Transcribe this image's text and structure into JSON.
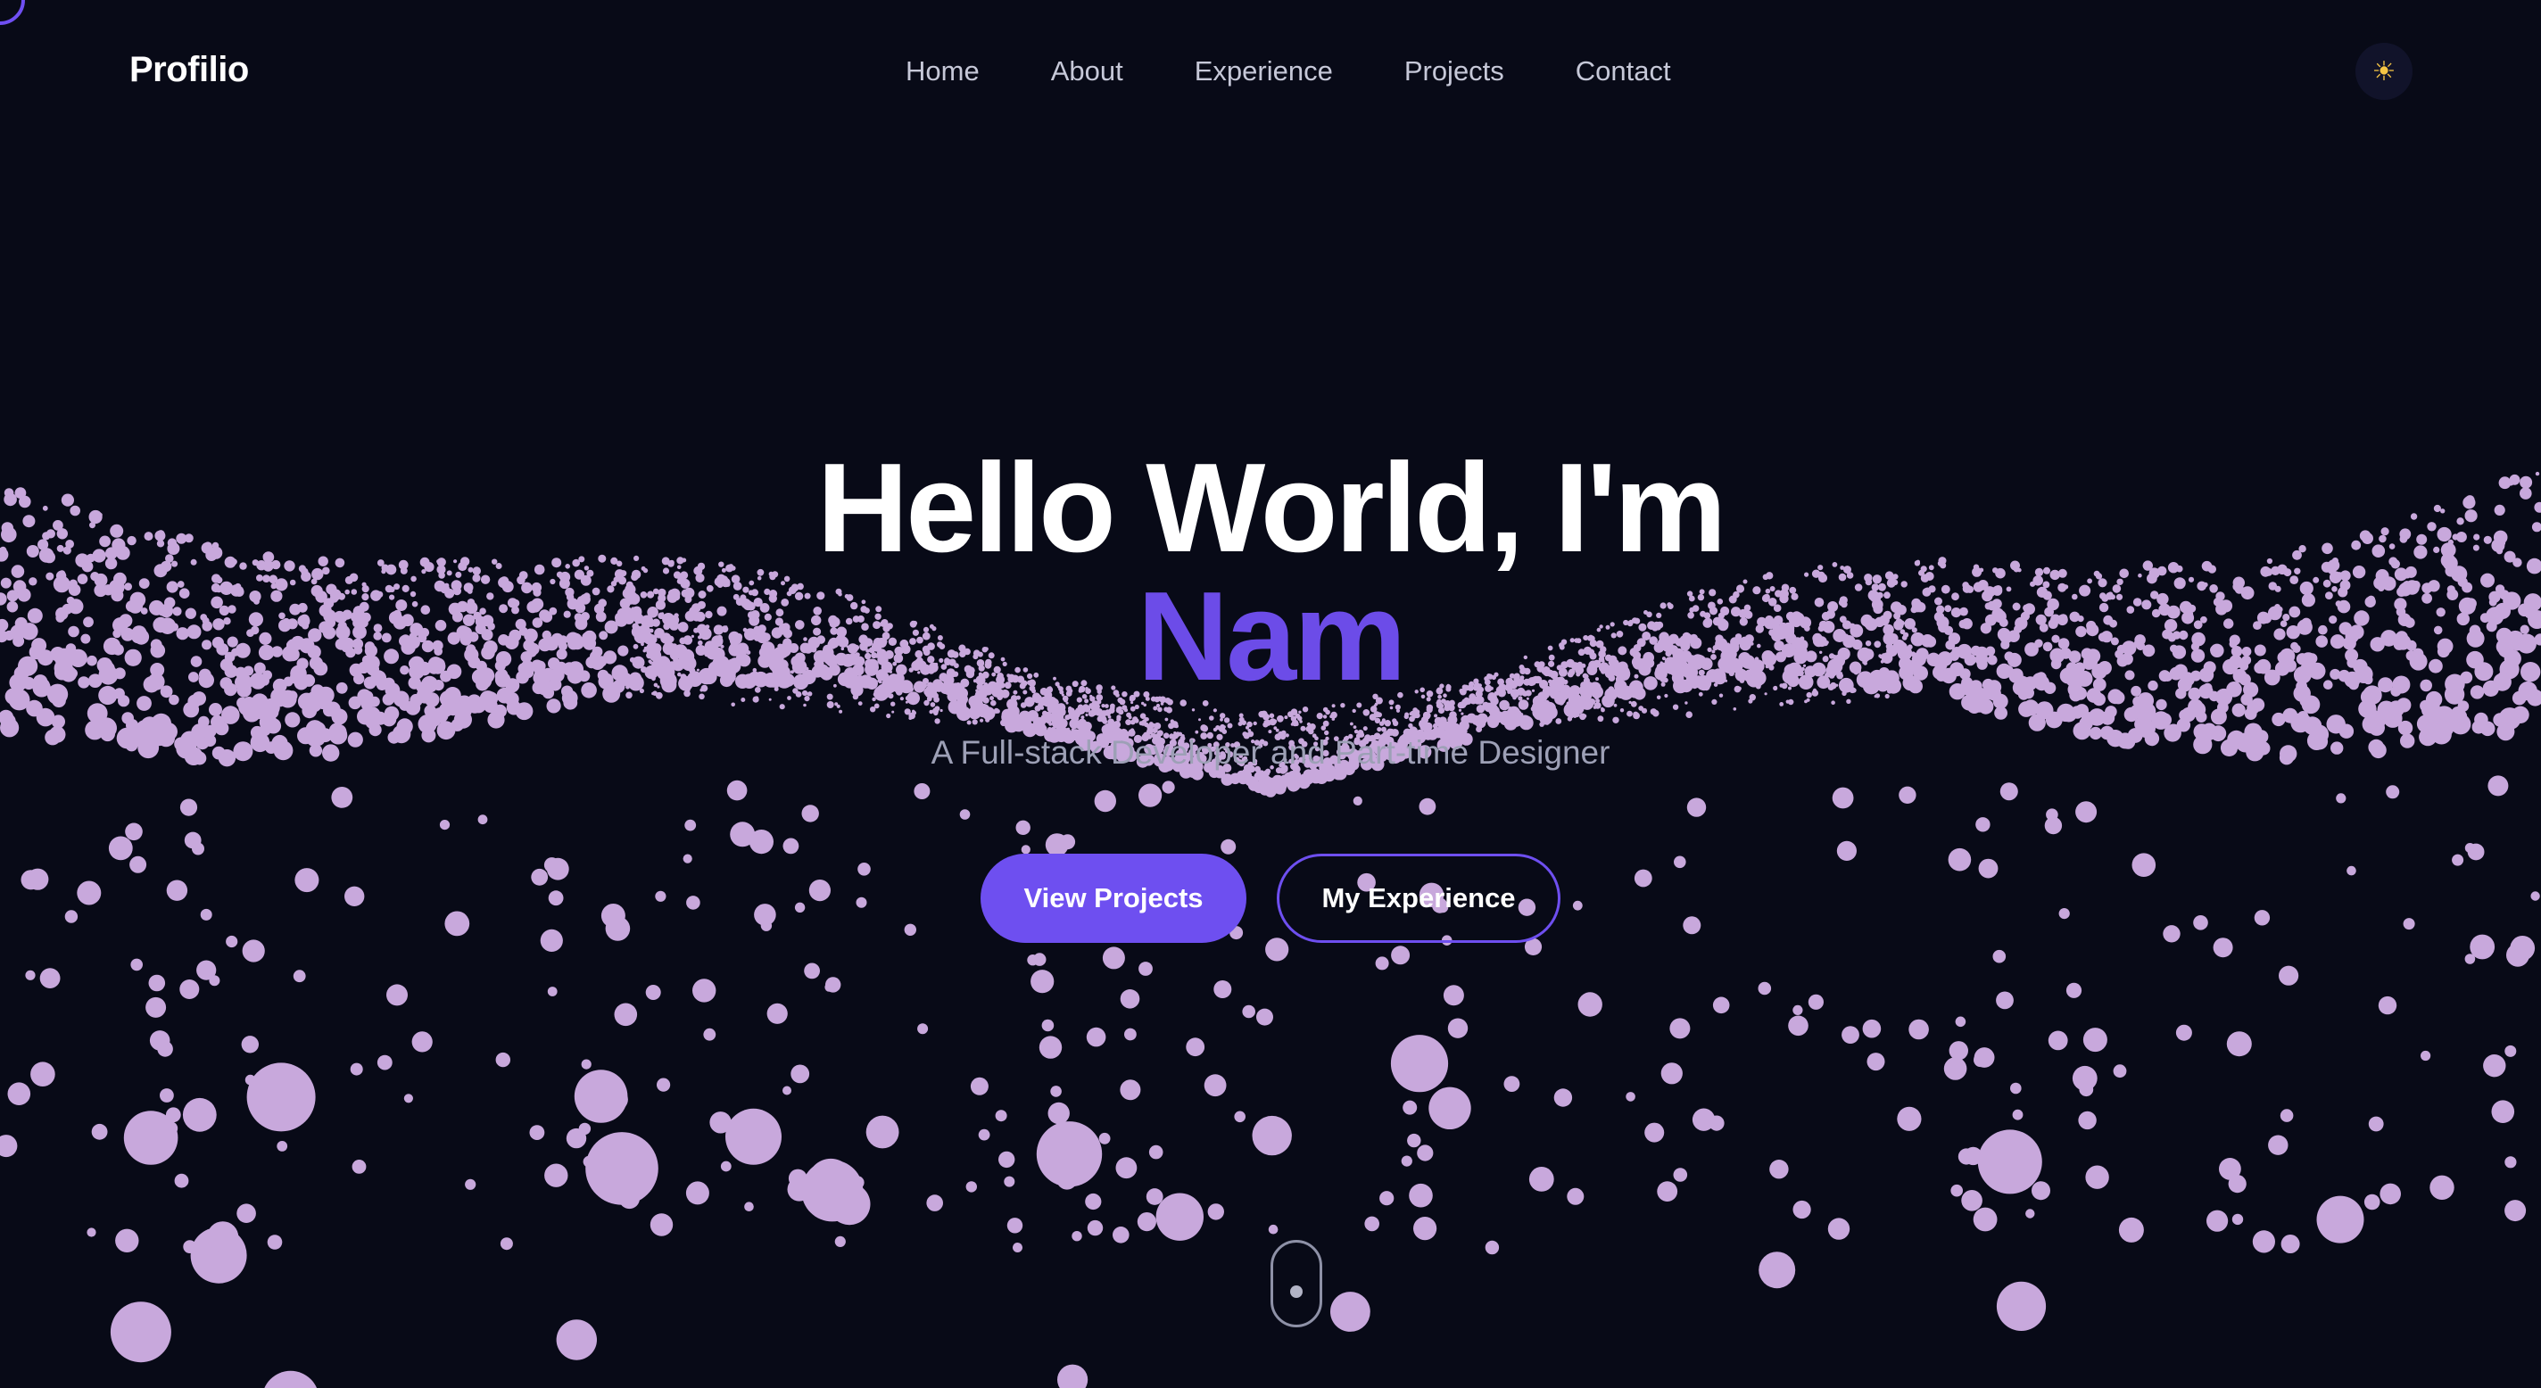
{
  "brand": {
    "name": "Profilio"
  },
  "nav": {
    "items": [
      {
        "label": "Home"
      },
      {
        "label": "About"
      },
      {
        "label": "Experience"
      },
      {
        "label": "Projects"
      },
      {
        "label": "Contact"
      }
    ]
  },
  "theme_toggle": {
    "icon": "sun-icon",
    "glyph": "☀"
  },
  "hero": {
    "greeting": "Hello World, I'm",
    "name": "Nam",
    "subtitle": "A Full-stack Developer and Part-time Designer"
  },
  "cta": {
    "primary_label": "View Projects",
    "secondary_label": "My Experience"
  },
  "colors": {
    "background": "#080a17",
    "accent": "#6e4ff0",
    "particle": "#c8a8dc",
    "text": "#ffffff",
    "muted": "#9da0b6"
  }
}
